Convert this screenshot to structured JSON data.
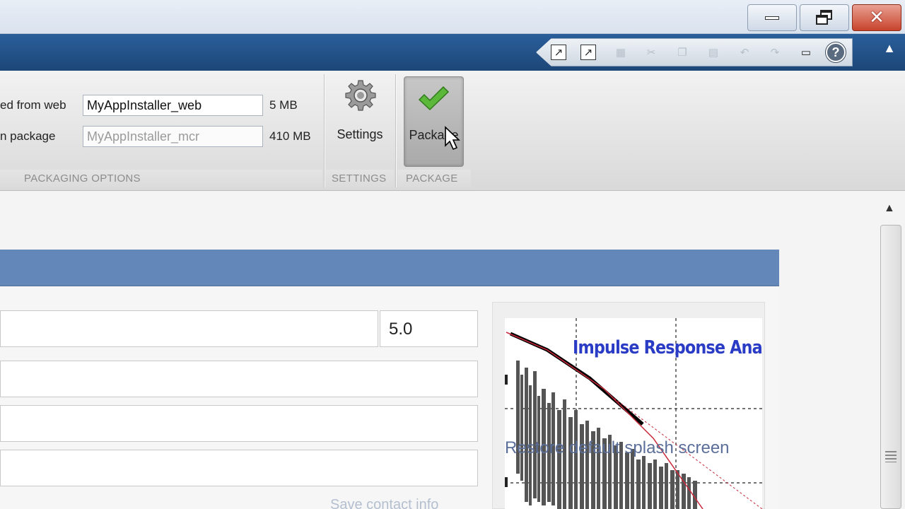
{
  "window": {
    "controls": {
      "minimize": "minimize",
      "restore": "restore",
      "close": "close"
    }
  },
  "quick_access": {
    "icons": [
      "undock-icon",
      "new-window-icon",
      "save-icon",
      "cut-icon",
      "copy-icon",
      "paste-icon",
      "undo-icon",
      "redo-icon",
      "layout-icon",
      "help-icon"
    ],
    "help_label": "?"
  },
  "ribbon": {
    "packaging_options": {
      "web_label": "ed from web",
      "web_value": "MyAppInstaller_web",
      "web_size": "5 MB",
      "package_label": "n package",
      "package_value": "MyAppInstaller_mcr",
      "package_size": "410 MB",
      "section_label": "PACKAGING OPTIONS"
    },
    "settings": {
      "button_label": "Settings",
      "section_label": "SETTINGS"
    },
    "package": {
      "button_label": "Package",
      "section_label": "PACKAGE"
    }
  },
  "main": {
    "version_value": "5.0",
    "faint_text": "Save contact info",
    "splash": {
      "title": "Impulse Response Analyzer",
      "restore_text": "Restore default splash screen"
    }
  }
}
